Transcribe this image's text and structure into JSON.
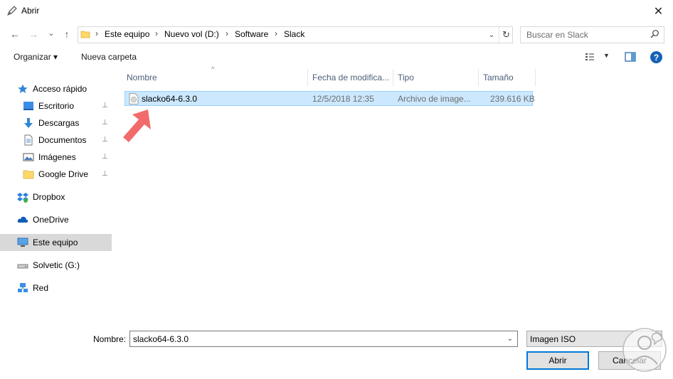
{
  "window": {
    "title": "Abrir",
    "close_glyph": "✕"
  },
  "nav": {
    "back_glyph": "←",
    "forward_glyph": "→",
    "recent_glyph": "⌄",
    "up_glyph": "↑",
    "breadcrumb": [
      "Este equipo",
      "Nuevo vol (D:)",
      "Software",
      "Slack"
    ],
    "separator": "›",
    "dropdown_glyph": "⌄",
    "refresh_glyph": "↻"
  },
  "search": {
    "placeholder": "Buscar en Slack"
  },
  "toolbar": {
    "organize_label": "Organizar ▾",
    "new_folder_label": "Nueva carpeta",
    "view_dd_glyph": "▼",
    "help_label": "?"
  },
  "sidebar": {
    "items": [
      {
        "label": "Acceso rápido",
        "icon": "star-icon",
        "pinned": false
      },
      {
        "label": "Escritorio",
        "icon": "desktop-icon",
        "pinned": true
      },
      {
        "label": "Descargas",
        "icon": "download-icon",
        "pinned": true
      },
      {
        "label": "Documentos",
        "icon": "document-icon",
        "pinned": true
      },
      {
        "label": "Imágenes",
        "icon": "pictures-icon",
        "pinned": true
      },
      {
        "label": "Google Drive",
        "icon": "folder-icon",
        "pinned": true
      },
      {
        "label": "Dropbox",
        "icon": "dropbox-icon",
        "pinned": false
      },
      {
        "label": "OneDrive",
        "icon": "cloud-icon",
        "pinned": false
      },
      {
        "label": "Este equipo",
        "icon": "computer-icon",
        "pinned": false,
        "selected": true
      },
      {
        "label": "Solvetic (G:)",
        "icon": "drive-icon",
        "pinned": false
      },
      {
        "label": "Red",
        "icon": "network-icon",
        "pinned": false
      }
    ],
    "pin_glyph": "📌"
  },
  "filelist": {
    "columns": [
      "Nombre",
      "Fecha de modifica...",
      "Tipo",
      "Tamaño"
    ],
    "sort_glyph": "^",
    "rows": [
      {
        "name": "slacko64-6.3.0",
        "date": "12/5/2018 12:35",
        "type": "Archivo de image...",
        "size": "239.616 KB",
        "selected": true
      }
    ]
  },
  "footer": {
    "name_label": "Nombre:",
    "name_value": "slacko64-6.3.0",
    "name_dd_glyph": "⌄",
    "filter_value": "Imagen ISO",
    "open_label": "Abrir",
    "cancel_label": "Cancelar"
  },
  "colors": {
    "accent": "#0078d7",
    "selection": "#cce8ff",
    "selection_border": "#99d1ff",
    "annotation_arrow": "#f26b6b"
  }
}
